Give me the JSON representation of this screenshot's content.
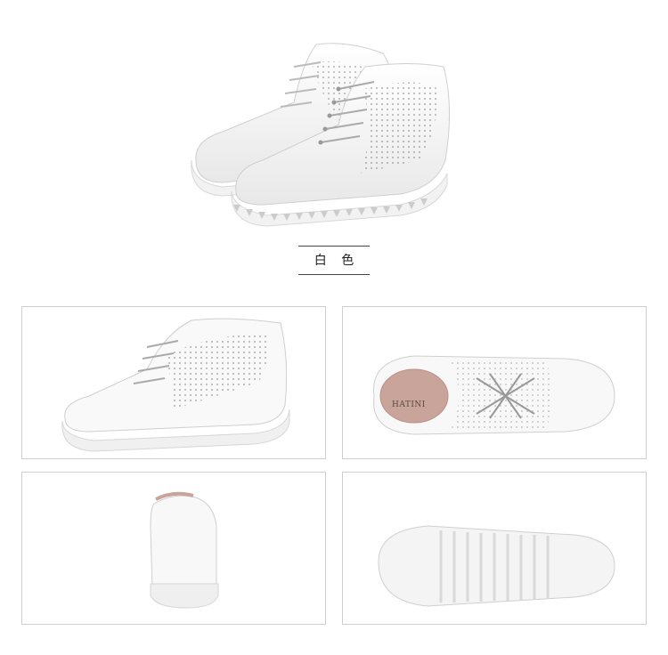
{
  "caption": {
    "color_label": "白 色"
  },
  "insole_brand": "HATINI",
  "colors": {
    "background": "#ffffff",
    "panel_border": "#cfcfcf",
    "shoe": "#f7f7f7",
    "shoe_shadow": "#dcdcdc",
    "lining": "#c9a49a"
  },
  "panels": [
    {
      "view": "side-view-shoe"
    },
    {
      "view": "top-view-shoe"
    },
    {
      "view": "back-view-shoe"
    },
    {
      "view": "sole-view-shoe"
    }
  ]
}
